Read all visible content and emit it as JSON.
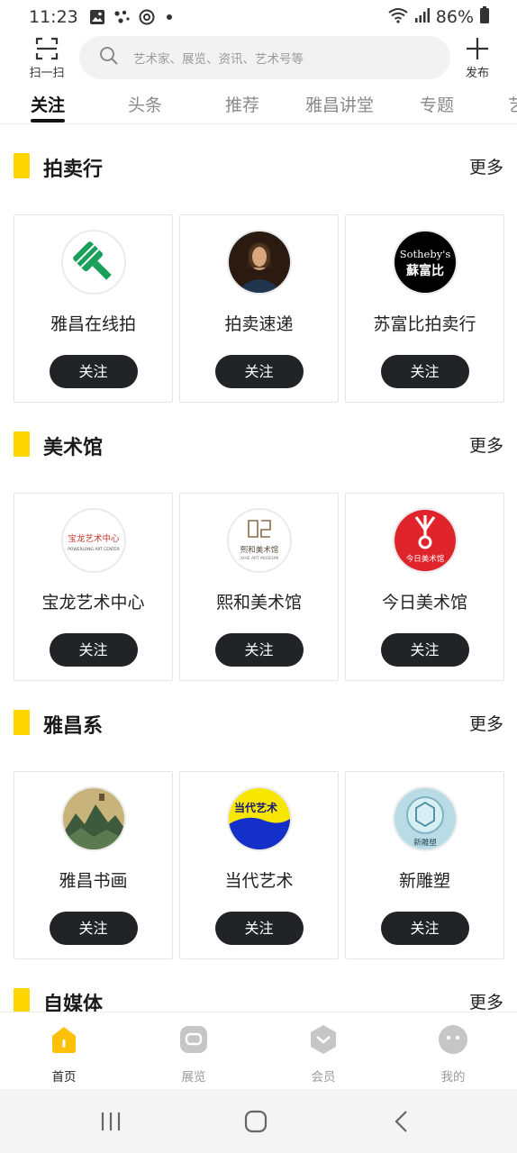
{
  "status_bar": {
    "time": "11:23",
    "battery": "86%",
    "icons": [
      "gallery-icon",
      "dots-icon",
      "sync-icon",
      "dot-icon",
      "wifi-icon",
      "signal-icon",
      "battery-icon"
    ]
  },
  "header": {
    "scan_label": "扫一扫",
    "search_placeholder": "艺术家、展览、资讯、艺术号等",
    "publish_label": "发布"
  },
  "tabs": [
    {
      "label": "关注",
      "active": true
    },
    {
      "label": "头条",
      "active": false
    },
    {
      "label": "推荐",
      "active": false
    },
    {
      "label": "雅昌讲堂",
      "active": false
    },
    {
      "label": "专题",
      "active": false
    },
    {
      "label": "艺",
      "active": false
    }
  ],
  "accent_color": "#ffd600",
  "follow_button_color": "#222326",
  "sections": [
    {
      "title": "拍卖行",
      "more": "更多",
      "cards": [
        {
          "name": "雅昌在线拍",
          "follow": "关注",
          "avatar_icon": "gavel-logo-icon"
        },
        {
          "name": "拍卖速递",
          "follow": "关注",
          "avatar_icon": "portrait-painting-icon"
        },
        {
          "name": "苏富比拍卖行",
          "follow": "关注",
          "avatar_icon": "sothebys-logo-icon",
          "logo_text_1": "Sotheby's",
          "logo_text_2": "蘇富比"
        }
      ]
    },
    {
      "title": "美术馆",
      "more": "更多",
      "cards": [
        {
          "name": "宝龙艺术中心",
          "follow": "关注",
          "avatar_icon": "powerlong-logo-icon",
          "logo_text_1": "宝龙艺术中心",
          "logo_text_2": "POWERLONG ART CENTER"
        },
        {
          "name": "熙和美术馆",
          "follow": "关注",
          "avatar_icon": "xihe-logo-icon",
          "logo_text_1": "熙和美术馆",
          "logo_text_2": "XIHE ART MUSEUM"
        },
        {
          "name": "今日美术馆",
          "follow": "关注",
          "avatar_icon": "today-art-logo-icon",
          "logo_text_1": "今日美术馆"
        }
      ]
    },
    {
      "title": "雅昌系",
      "more": "更多",
      "cards": [
        {
          "name": "雅昌书画",
          "follow": "关注",
          "avatar_icon": "landscape-painting-icon"
        },
        {
          "name": "当代艺术",
          "follow": "关注",
          "avatar_icon": "contemporary-art-logo-icon",
          "logo_text_1": "当代艺术"
        },
        {
          "name": "新雕塑",
          "follow": "关注",
          "avatar_icon": "sculpture-logo-icon",
          "logo_text_1": "新雕塑"
        }
      ]
    },
    {
      "title": "自媒体",
      "more": "更多",
      "cards": []
    }
  ],
  "bottom_nav": [
    {
      "label": "首页",
      "active": true,
      "icon": "home-icon"
    },
    {
      "label": "展览",
      "active": false,
      "icon": "exhibition-icon"
    },
    {
      "label": "会员",
      "active": false,
      "icon": "member-icon"
    },
    {
      "label": "我的",
      "active": false,
      "icon": "profile-icon"
    }
  ]
}
